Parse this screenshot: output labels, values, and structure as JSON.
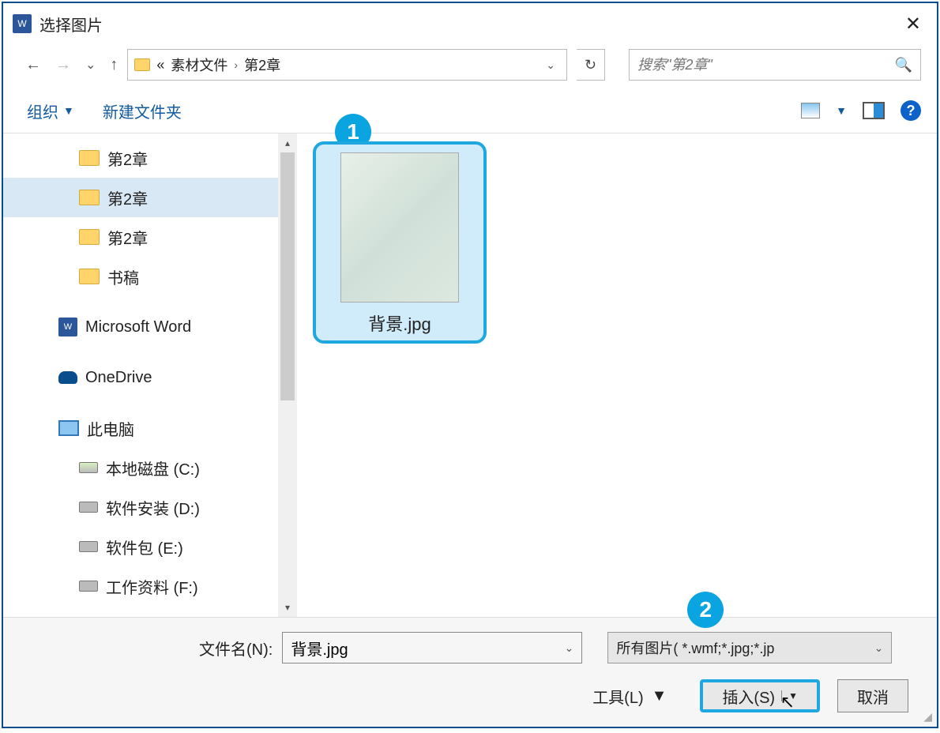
{
  "title": "选择图片",
  "breadcrumb": {
    "prefix": "«",
    "parts": [
      "素材文件",
      "第2章"
    ]
  },
  "search": {
    "placeholder": "搜索\"第2章\""
  },
  "toolbar": {
    "organize": "组织",
    "new_folder": "新建文件夹"
  },
  "tree": {
    "items": [
      {
        "label": "第2章",
        "type": "folder",
        "level": 1,
        "selected": false
      },
      {
        "label": "第2章",
        "type": "folder",
        "level": 1,
        "selected": true
      },
      {
        "label": "第2章",
        "type": "folder",
        "level": 1,
        "selected": false
      },
      {
        "label": "书稿",
        "type": "folder",
        "level": 1,
        "selected": false
      },
      {
        "label": "Microsoft Word",
        "type": "word",
        "level": 0,
        "selected": false
      },
      {
        "label": "OneDrive",
        "type": "onedrive",
        "level": 0,
        "selected": false
      },
      {
        "label": "此电脑",
        "type": "pc",
        "level": 0,
        "selected": false
      },
      {
        "label": "本地磁盘 (C:)",
        "type": "drive-c",
        "level": 1,
        "selected": false
      },
      {
        "label": "软件安装 (D:)",
        "type": "drive",
        "level": 1,
        "selected": false
      },
      {
        "label": "软件包 (E:)",
        "type": "drive",
        "level": 1,
        "selected": false
      },
      {
        "label": "工作资料 (F:)",
        "type": "drive",
        "level": 1,
        "selected": false
      }
    ]
  },
  "files": [
    {
      "name": "背景.jpg",
      "selected": true
    }
  ],
  "callouts": {
    "one": "1",
    "two": "2"
  },
  "footer": {
    "filename_label": "文件名(N):",
    "filename_value": "背景.jpg",
    "filter": "所有图片(       *.wmf;*.jpg;*.jp",
    "tools": "工具(L)",
    "insert": "插入(S)",
    "cancel": "取消"
  }
}
